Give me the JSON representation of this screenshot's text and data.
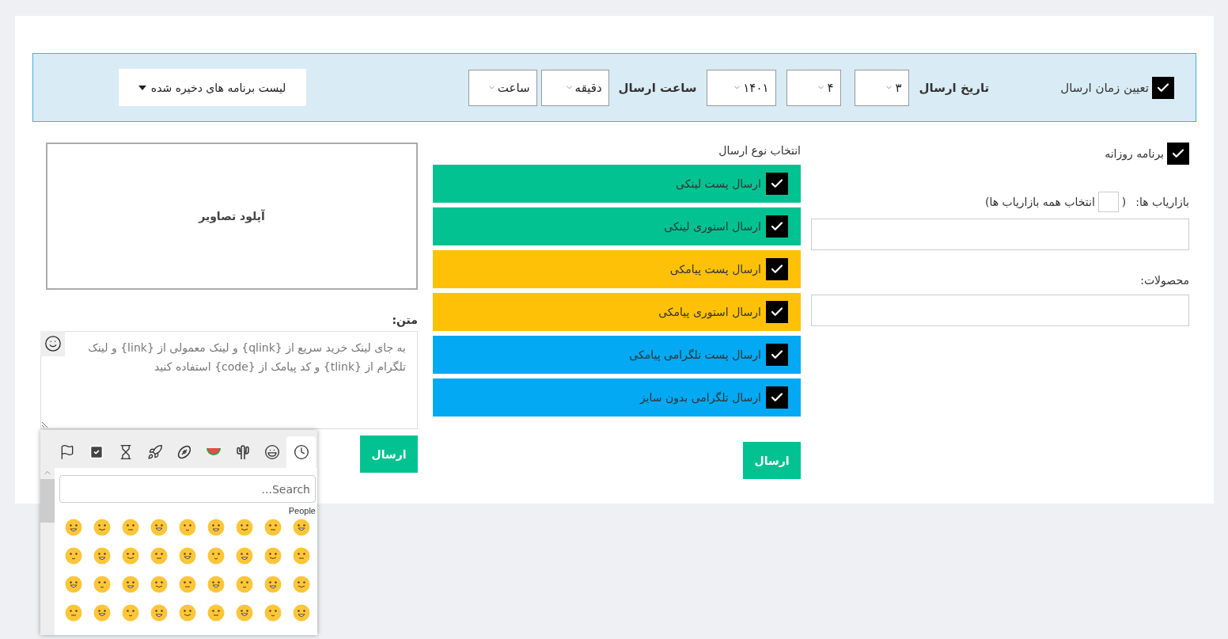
{
  "schedule": {
    "enable": {
      "label": "تعیین زمان ارسال",
      "checked": true
    },
    "date_label": "تاریخ ارسال",
    "date_fields": [
      {
        "value": "۳"
      },
      {
        "value": "۴"
      },
      {
        "value": "۱۴۰۱"
      }
    ],
    "time_label": "ساعت ارسال",
    "time_fields": [
      {
        "value": "دقیقه"
      },
      {
        "value": "ساعت"
      }
    ],
    "saved_list_button": "لیست برنامه های دخیره شده"
  },
  "daily_program": {
    "label": "برنامه روزانه",
    "checked": true
  },
  "marketers": {
    "label": "بازاریاب ها:",
    "open_paren": "(",
    "select_all": {
      "label": "انتخاب همه بازاریاب ها)",
      "checked": false
    }
  },
  "products": {
    "label": "محصولات:"
  },
  "send_types": {
    "heading": "انتخاب نوع ارسال",
    "items": [
      {
        "label": "ارسال پست لینکی",
        "checked": true,
        "color": "#03c292"
      },
      {
        "label": "ارسال استوری لینکی",
        "checked": true,
        "color": "#03c292"
      },
      {
        "label": "ارسال پست پیامکی",
        "checked": true,
        "color": "#fec107"
      },
      {
        "label": "ارسال استوری پیامکی",
        "checked": true,
        "color": "#fec107"
      },
      {
        "label": "ارسال پست تلگرامی پیامکی",
        "checked": true,
        "color": "#03a9f3"
      },
      {
        "label": "ارسال تلگرامی بدون سایز",
        "checked": true,
        "color": "#03a9f3"
      }
    ],
    "send_button": "ارسال"
  },
  "upload": {
    "label": "آپلود تصاویر"
  },
  "message": {
    "label": "متن:",
    "placeholder": "به جای لینک خرید سریع از {qlink} و لینک معمولی از {link} و لینک تلگرام از {tlink} و کد پیامک از {code} استفاده کنید",
    "send_button": "ارسال"
  },
  "emoji_picker": {
    "tabs": [
      {
        "kind": "clock",
        "selected": true
      },
      {
        "kind": "smiley",
        "selected": false
      },
      {
        "kind": "cactus",
        "selected": false
      },
      {
        "kind": "watermelon",
        "selected": false
      },
      {
        "kind": "football",
        "selected": false
      },
      {
        "kind": "rocket",
        "selected": false
      },
      {
        "kind": "hourglass",
        "selected": false
      },
      {
        "kind": "checkbox",
        "selected": false
      },
      {
        "kind": "flag",
        "selected": false
      }
    ],
    "search_placeholder": "Search...",
    "category": "People"
  }
}
